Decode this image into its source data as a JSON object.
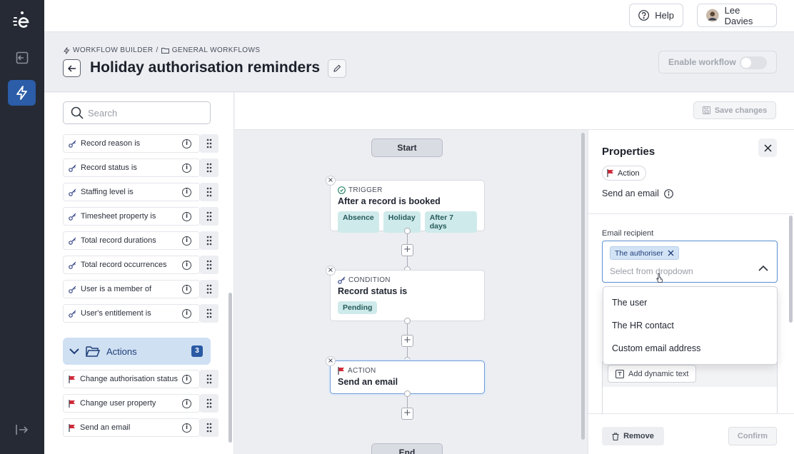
{
  "topbar": {
    "help_label": "Help",
    "user_name": "Lee Davies"
  },
  "header": {
    "breadcrumb": [
      "WORKFLOW BUILDER",
      "/",
      "GENERAL WORKFLOWS"
    ],
    "title": "Holiday authorisation reminders",
    "enable_label": "Enable workflow",
    "enabled": false
  },
  "sidebar": {
    "search_placeholder": "Search",
    "conditions": [
      {
        "label": "Record reason is"
      },
      {
        "label": "Record status is"
      },
      {
        "label": "Staffing level is"
      },
      {
        "label": "Timesheet property is"
      },
      {
        "label": "Total record durations"
      },
      {
        "label": "Total record occurrences"
      },
      {
        "label": "User is a member of"
      },
      {
        "label": "User's entitlement is"
      }
    ],
    "actions_group": {
      "label": "Actions",
      "count": "3"
    },
    "actions": [
      {
        "label": "Change authorisation status"
      },
      {
        "label": "Change user property"
      },
      {
        "label": "Send an email"
      }
    ]
  },
  "canvas": {
    "save_label": "Save changes",
    "start_label": "Start",
    "end_label": "End",
    "trigger": {
      "kind": "TRIGGER",
      "title": "After a record is booked",
      "tags": [
        "Absence",
        "Holiday",
        "After 7 days"
      ]
    },
    "condition": {
      "kind": "CONDITION",
      "title": "Record status is",
      "tags": [
        "Pending"
      ]
    },
    "action": {
      "kind": "ACTION",
      "title": "Send an email"
    }
  },
  "properties": {
    "title": "Properties",
    "badge": "Action",
    "subtitle": "Send an email",
    "recipient_label": "Email recipient",
    "recipient_chip": "The authoriser",
    "recipient_placeholder": "Select from dropdown",
    "options": [
      "The user",
      "The HR contact",
      "Custom email address"
    ],
    "dynamic_text_label": "Add dynamic text",
    "remove_label": "Remove",
    "confirm_label": "Confirm"
  },
  "colors": {
    "rail": "#252a35",
    "accent": "#2b5da8",
    "tag_bg": "#cfeaea",
    "flag_red": "#d12a3a"
  }
}
